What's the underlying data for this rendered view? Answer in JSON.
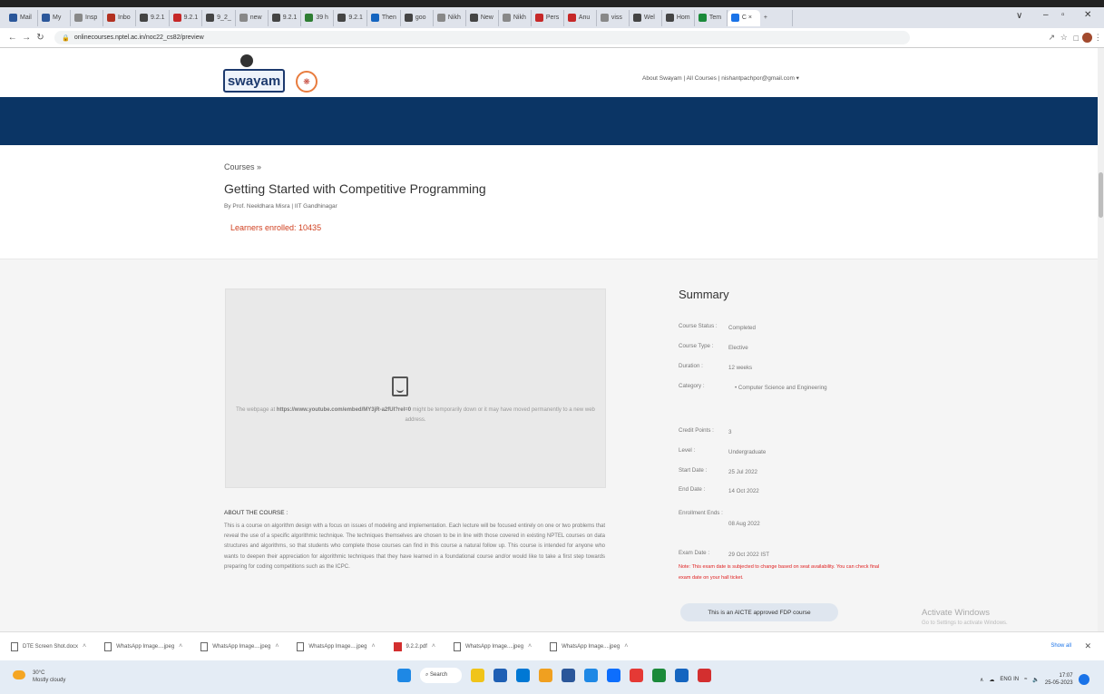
{
  "browser": {
    "tabs": [
      {
        "label": "Mail",
        "color": "#2b579a"
      },
      {
        "label": "My",
        "color": "#2b579a"
      },
      {
        "label": "Insp",
        "color": "#888888"
      },
      {
        "label": "Inbo",
        "color": "#b23121"
      },
      {
        "label": "9.2.1",
        "color": "#444444"
      },
      {
        "label": "9.2.1",
        "color": "#c62828"
      },
      {
        "label": "9_2_",
        "color": "#444444"
      },
      {
        "label": "new",
        "color": "#888888"
      },
      {
        "label": "9.2.1",
        "color": "#444444"
      },
      {
        "label": "39 h",
        "color": "#2e7d32"
      },
      {
        "label": "9.2.1",
        "color": "#444444"
      },
      {
        "label": "Then",
        "color": "#1565c0"
      },
      {
        "label": "goo",
        "color": "#444444"
      },
      {
        "label": "Nikh",
        "color": "#888888"
      },
      {
        "label": "New",
        "color": "#444444"
      },
      {
        "label": "Nikh",
        "color": "#888888"
      },
      {
        "label": "Pers",
        "color": "#c62828"
      },
      {
        "label": "Anu",
        "color": "#c62828"
      },
      {
        "label": "viss",
        "color": "#888888"
      },
      {
        "label": "Wel",
        "color": "#444444"
      },
      {
        "label": "Hom",
        "color": "#444444"
      },
      {
        "label": "Tem",
        "color": "#1b8a3a"
      }
    ],
    "active_tab": "C ×",
    "url": "onlinecourses.nptel.ac.in/noc22_cs82/preview",
    "new_tab": "+"
  },
  "site": {
    "logo": "swayam",
    "top_links": "About Swayam  |  All Courses  |  nishantpachpor@gmail.com ▾"
  },
  "course": {
    "breadcrumb": "Courses  »",
    "title": "Getting Started with Competitive Programming",
    "byline": "By Prof. Neeldhara Misra   |   IIT Gandhinagar",
    "enrolled": "Learners enrolled: 10435"
  },
  "video": {
    "msg_prefix": "The webpage at ",
    "msg_url": "https://www.youtube.com/embed/MY3jR-a2fUI?rel=0",
    "msg_suffix": " might be temporarily down or it may have moved permanently to a new web address."
  },
  "about": {
    "heading": "ABOUT THE COURSE :",
    "text": "This is a course on algorithm design with a focus on issues of modeling and implementation. Each lecture will be focused entirely on one or two problems that reveal the use of a specific algorithmic technique. The techniques themselves are chosen to be in line with those covered in existing NPTEL courses on data structures and algorithms, so that students who complete those courses can find in this course a natural follow up. This course is intended for anyone who wants to deepen their appreciation for algorithmic techniques that they have learned in a foundational course and/or would like to take a first step towards preparing for coding competitions such as the ICPC."
  },
  "summary": {
    "heading": "Summary",
    "rows": [
      {
        "k": "Course Status :",
        "v": "Completed"
      },
      {
        "k": "Course Type :",
        "v": "Elective"
      },
      {
        "k": "Duration :",
        "v": "12 weeks"
      },
      {
        "k": "Category :",
        "v": "•  Computer Science and Engineering"
      },
      {
        "k": "Credit Points :",
        "v": "3"
      },
      {
        "k": "Level :",
        "v": "Undergraduate"
      },
      {
        "k": "Start Date :",
        "v": "25 Jul 2022"
      },
      {
        "k": "End Date :",
        "v": "14 Oct 2022"
      },
      {
        "k": "Enrollment Ends :",
        "v": "08 Aug 2022"
      },
      {
        "k": "Exam Date :",
        "v": "29 Oct 2022 IST"
      }
    ],
    "note": "Note: This exam date is subjected to change based on seat availability. You can check final exam date on your hall ticket.",
    "aicte": "This is an AICTE approved FDP course"
  },
  "windows": {
    "activate": "Activate Windows",
    "activate_sub": "Go to Settings to activate Windows."
  },
  "downloads": {
    "items": [
      {
        "name": "DTE Screen Shot.docx",
        "type": "doc"
      },
      {
        "name": "WhatsApp Image....jpeg",
        "type": "img"
      },
      {
        "name": "WhatsApp Image....jpeg",
        "type": "img"
      },
      {
        "name": "WhatsApp Image....jpeg",
        "type": "img"
      },
      {
        "name": "9.2.2.pdf",
        "type": "pdf"
      },
      {
        "name": "WhatsApp Image....jpeg",
        "type": "img"
      },
      {
        "name": "WhatsApp Image....jpeg",
        "type": "img"
      }
    ],
    "show_all": "Show all"
  },
  "taskbar": {
    "weather_temp": "30°C",
    "weather_desc": "Mostly cloudy",
    "search": "Search",
    "lang": "ENG IN",
    "time": "17:07",
    "date": "25-05-2023",
    "icon_colors": [
      "#f0c419",
      "#1e5fb4",
      "#0078d4",
      "#f0a020",
      "#2b579a",
      "#1e88e5",
      "#0d6efd",
      "#e53935",
      "#1b8a3a",
      "#1565c0",
      "#d32f2f"
    ]
  }
}
